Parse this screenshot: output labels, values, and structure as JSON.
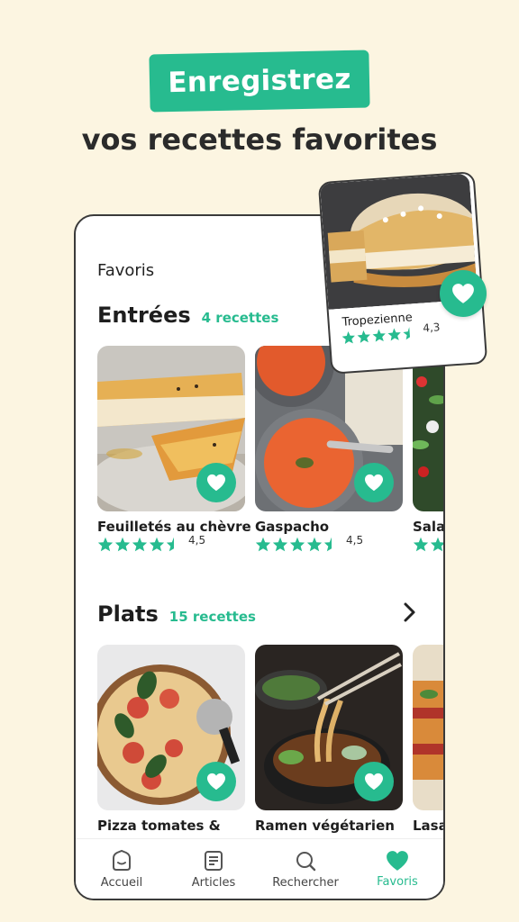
{
  "promo": {
    "headline": "Enregistrez",
    "subheadline": "vos recettes favorites"
  },
  "screen": {
    "title": "Favoris"
  },
  "sections": [
    {
      "name": "Entrées",
      "count": "4 recettes",
      "recipes": [
        {
          "title": "Feuilletés au chèvre",
          "rating": "4,5",
          "stars": 4.5
        },
        {
          "title": "Gaspacho",
          "rating": "4,5",
          "stars": 4.5
        },
        {
          "title": "Sala",
          "rating": "",
          "stars": 4.5
        }
      ]
    },
    {
      "name": "Plats",
      "count": "15 recettes",
      "recipes": [
        {
          "title": "Pizza tomates &",
          "rating": "",
          "stars": 0
        },
        {
          "title": "Ramen végétarien",
          "rating": "",
          "stars": 0
        },
        {
          "title": "Lasa",
          "rating": "",
          "stars": 0
        }
      ]
    }
  ],
  "featured": {
    "title": "Tropezienne",
    "rating": "4,3",
    "stars": 4.5
  },
  "tabs": [
    {
      "label": "Accueil",
      "icon": "home-icon",
      "active": false
    },
    {
      "label": "Articles",
      "icon": "articles-icon",
      "active": false
    },
    {
      "label": "Rechercher",
      "icon": "search-icon",
      "active": false
    },
    {
      "label": "Favoris",
      "icon": "heart-icon",
      "active": true
    }
  ],
  "colors": {
    "accent": "#27bb8f",
    "background": "#fcf5e1"
  }
}
